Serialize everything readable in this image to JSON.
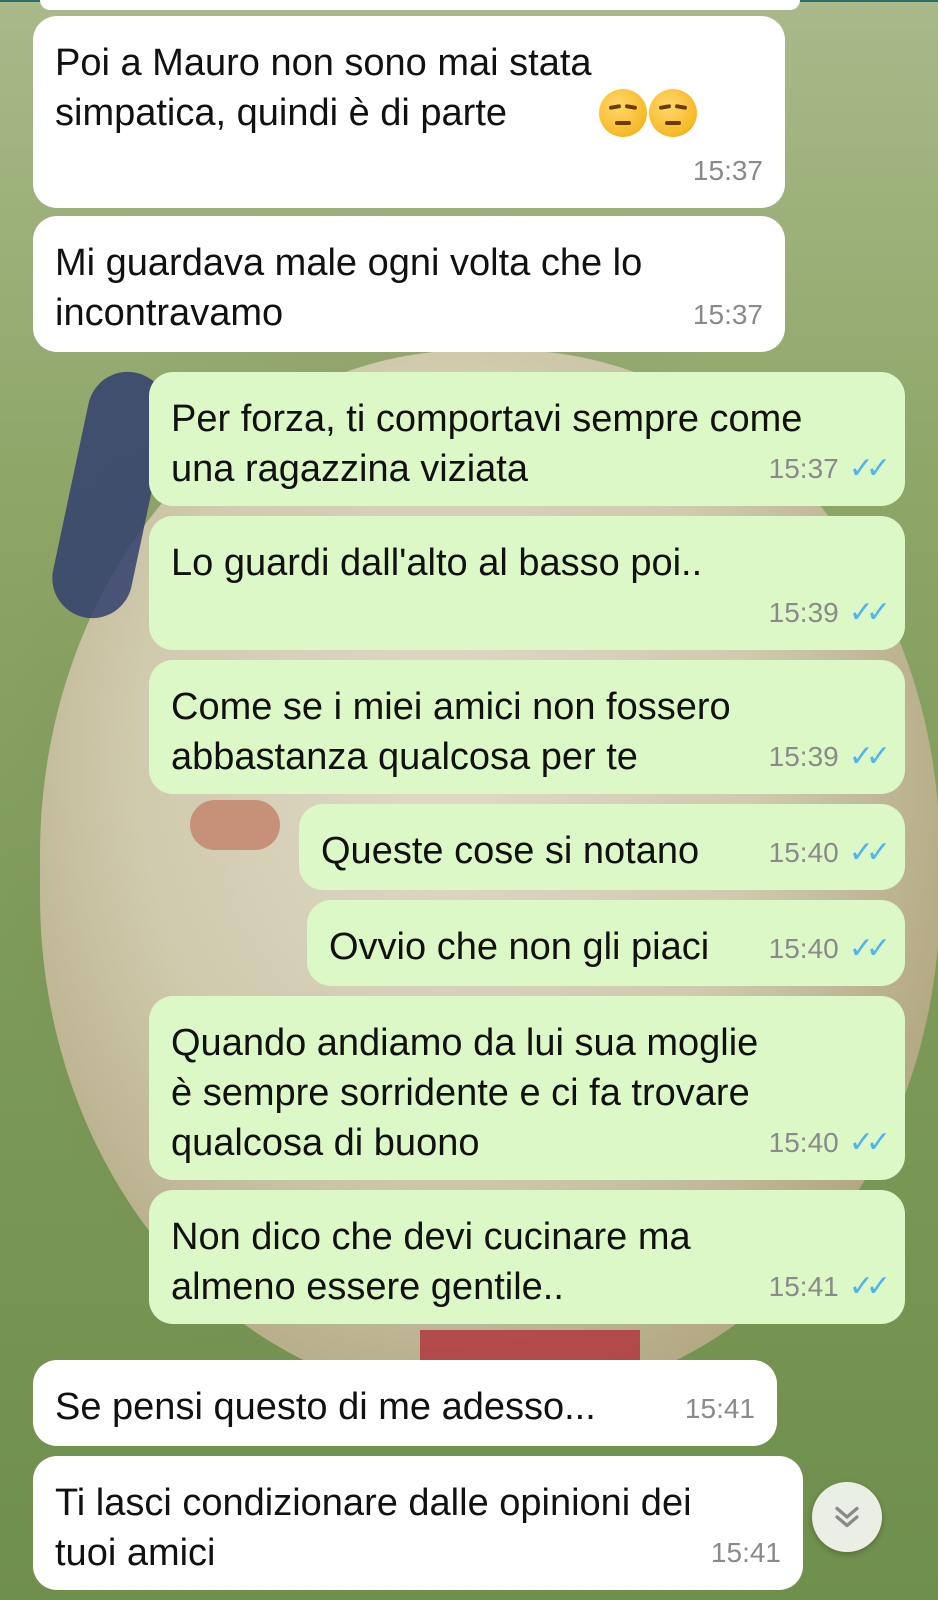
{
  "messages": [
    {
      "dir": "in",
      "text": "Poi a Mauro non sono mai stata\nsimpatica, quindi è di parte",
      "emoji": "unamused-face-emoji x2",
      "time": "15:37"
    },
    {
      "dir": "in",
      "text": "Mi guardava male ogni volta che lo\nincontravamo",
      "time": "15:37"
    },
    {
      "dir": "out",
      "text": "Per forza, ti comportavi sempre come\nuna ragazzina viziata",
      "time": "15:37",
      "ticks": "✓✓"
    },
    {
      "dir": "out",
      "text": "Lo guardi dall'alto al basso poi..",
      "time": "15:39",
      "ticks": "✓✓"
    },
    {
      "dir": "out",
      "text": "Come se i miei amici non fossero\nabbastanza qualcosa per te",
      "time": "15:39",
      "ticks": "✓✓"
    },
    {
      "dir": "out",
      "text": "Queste cose si notano",
      "time": "15:40",
      "ticks": "✓✓"
    },
    {
      "dir": "out",
      "text": "Ovvio che non gli piaci",
      "time": "15:40",
      "ticks": "✓✓"
    },
    {
      "dir": "out",
      "text": "Quando andiamo da lui sua moglie\nè sempre sorridente e ci fa trovare\nqualcosa di buono",
      "time": "15:40",
      "ticks": "✓✓"
    },
    {
      "dir": "out",
      "text": "Non dico che devi cucinare ma\nalmeno essere gentile..",
      "time": "15:41",
      "ticks": "✓✓"
    },
    {
      "dir": "in",
      "text": "Se pensi questo di me adesso...",
      "time": "15:41"
    },
    {
      "dir": "in",
      "text": "Ti lasci condizionare dalle opinioni dei\ntuoi amici",
      "time": "15:41"
    }
  ],
  "scroll_button": {
    "icon": "chevron-double-down-icon"
  },
  "colors": {
    "incoming": "#ffffff",
    "outgoing": "#dcf8c6",
    "read_ticks": "#4fb6ec",
    "time": "#8a8a8a"
  }
}
